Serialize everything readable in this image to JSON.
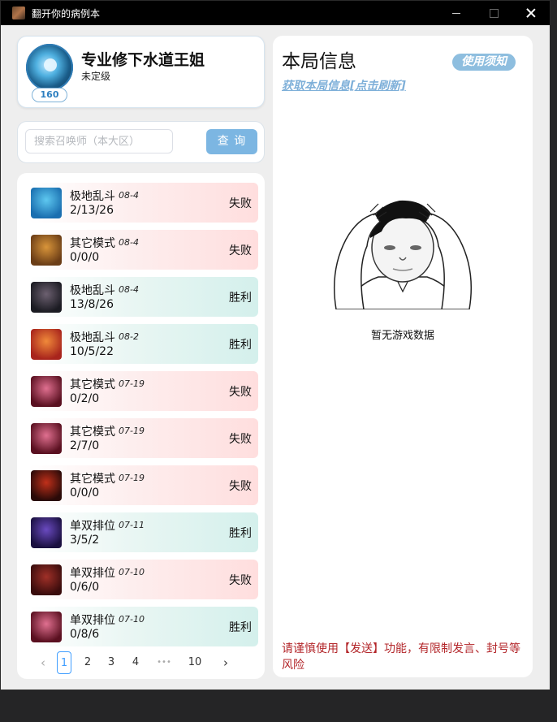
{
  "window": {
    "title": "翻开你的病例本"
  },
  "profile": {
    "name": "专业修下水道王姐",
    "rank": "未定级",
    "level": "160"
  },
  "search": {
    "placeholder": "搜索召唤师（本大区）",
    "value": "",
    "button": "查 询"
  },
  "matches": [
    {
      "mode": "极地乱斗",
      "date": "08-4",
      "kda": "2/13/26",
      "result": "失败",
      "outcome": "loss",
      "champion_icon": "blue-haired-champion-icon"
    },
    {
      "mode": "其它模式",
      "date": "08-4",
      "kda": "0/0/0",
      "result": "失败",
      "outcome": "loss",
      "champion_icon": "yordle-goggles-champion-icon"
    },
    {
      "mode": "极地乱斗",
      "date": "08-4",
      "kda": "13/8/26",
      "result": "胜利",
      "outcome": "win",
      "champion_icon": "dark-warrior-champion-icon"
    },
    {
      "mode": "极地乱斗",
      "date": "08-2",
      "kda": "10/5/22",
      "result": "胜利",
      "outcome": "win",
      "champion_icon": "red-haired-champion-icon"
    },
    {
      "mode": "其它模式",
      "date": "07-19",
      "kda": "0/2/0",
      "result": "失败",
      "outcome": "loss",
      "champion_icon": "red-haired-duelist-icon"
    },
    {
      "mode": "其它模式",
      "date": "07-19",
      "kda": "2/7/0",
      "result": "失败",
      "outcome": "loss",
      "champion_icon": "red-haired-duelist-icon"
    },
    {
      "mode": "其它模式",
      "date": "07-19",
      "kda": "0/0/0",
      "result": "失败",
      "outcome": "loss",
      "champion_icon": "dark-beast-champion-icon"
    },
    {
      "mode": "单双排位",
      "date": "07-11",
      "kda": "3/5/2",
      "result": "胜利",
      "outcome": "win",
      "champion_icon": "dark-mage-champion-icon"
    },
    {
      "mode": "单双排位",
      "date": "07-10",
      "kda": "0/6/0",
      "result": "失败",
      "outcome": "loss",
      "champion_icon": "brawler-champion-icon"
    },
    {
      "mode": "单双排位",
      "date": "07-10",
      "kda": "0/8/6",
      "result": "胜利",
      "outcome": "win",
      "champion_icon": "red-haired-duelist-icon"
    }
  ],
  "pagination": {
    "prev": "‹",
    "pages": [
      "1",
      "2",
      "3",
      "4"
    ],
    "ellipsis": "•••",
    "last": "10",
    "next": "›",
    "current": "1"
  },
  "game_info": {
    "title": "本局信息",
    "usage_notice": "使用须知",
    "refresh_link": "获取本局信息[点击刷新]",
    "empty_text": "暂无游戏数据",
    "warning": "请谨慎使用【发送】功能，有限制发言、封号等风险"
  },
  "colors": {
    "accent": "#7cb6e2",
    "loss": "#ffdede",
    "win": "#d4f0ec",
    "warning": "#b3262a",
    "link": "#7fb0d9"
  }
}
